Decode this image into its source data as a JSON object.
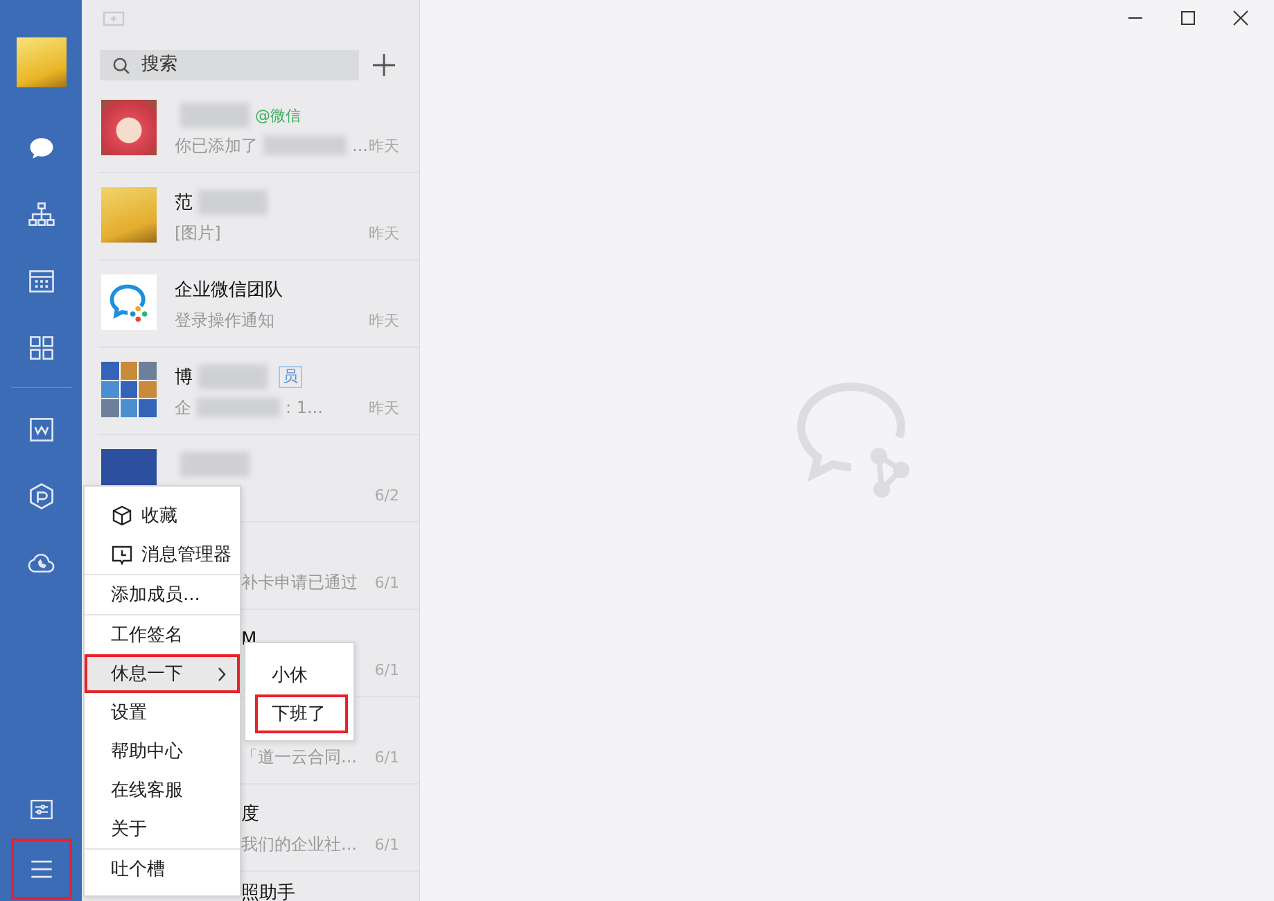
{
  "nav": {
    "top_items": [
      {
        "selected": true
      },
      {
        "selected": false
      },
      {
        "selected": false
      },
      {
        "selected": false
      }
    ],
    "app_items": [
      {
        "selected": false
      },
      {
        "selected": false
      },
      {
        "selected": false
      }
    ],
    "bottom_items": [
      {
        "highlighted": false
      },
      {
        "highlighted": true
      }
    ]
  },
  "search": {
    "placeholder": "搜索"
  },
  "chats": [
    {
      "kind": "full",
      "name": [
        {
          "kind": "blur"
        },
        {
          "kind": "mention",
          "text": "@微信"
        }
      ],
      "preview": [
        {
          "kind": "text",
          "text": "你已添加了"
        },
        {
          "kind": "blur"
        },
        {
          "kind": "text",
          "text": "..."
        }
      ],
      "time": "昨天"
    },
    {
      "kind": "full",
      "name": [
        {
          "kind": "text",
          "text": "范"
        },
        {
          "kind": "blur"
        }
      ],
      "preview": [
        {
          "kind": "text",
          "text": "[图片]"
        }
      ],
      "time": "昨天"
    },
    {
      "kind": "full",
      "name": [
        {
          "kind": "text",
          "text": "企业微信团队"
        }
      ],
      "preview": [
        {
          "kind": "text",
          "text": "登录操作通知"
        }
      ],
      "time": "昨天"
    },
    {
      "kind": "full",
      "name": [
        {
          "kind": "text",
          "text": "博"
        },
        {
          "kind": "blur"
        },
        {
          "kind": "tag",
          "text": "员"
        }
      ],
      "preview": [
        {
          "kind": "text",
          "text": "企"
        },
        {
          "kind": "blur"
        },
        {
          "kind": "text",
          "text": ": 1..."
        }
      ],
      "time": "昨天"
    },
    {
      "kind": "full",
      "name": [
        {
          "kind": "blur"
        }
      ],
      "time": "6/2"
    },
    {
      "kind": "behind",
      "preview": [
        {
          "kind": "text",
          "text": "补卡申请已通过"
        }
      ],
      "time": "6/1"
    },
    {
      "kind": "behind",
      "name": [
        {
          "kind": "text",
          "text": "M"
        }
      ],
      "time": "6/1"
    },
    {
      "kind": "behind",
      "preview": [
        {
          "kind": "text",
          "text": "「道一云合同..."
        }
      ],
      "time": "6/1"
    },
    {
      "kind": "behind",
      "name": [
        {
          "kind": "text",
          "text": "度"
        }
      ],
      "preview": [
        {
          "kind": "text",
          "text": "我们的企业社..."
        }
      ],
      "time": "6/1"
    },
    {
      "kind": "behind",
      "name": [
        {
          "kind": "text",
          "text": "照助手"
        }
      ]
    }
  ],
  "menu": {
    "items": [
      {
        "kind": "item",
        "label": "收藏",
        "submenu": false,
        "hovered": false,
        "highlighted": false
      },
      {
        "kind": "item",
        "label": "消息管理器",
        "submenu": false,
        "hovered": false,
        "highlighted": false
      },
      {
        "kind": "divider"
      },
      {
        "kind": "item",
        "label": "添加成员...",
        "submenu": false,
        "hovered": false,
        "highlighted": false
      },
      {
        "kind": "divider"
      },
      {
        "kind": "item",
        "label": "工作签名",
        "submenu": false,
        "hovered": false,
        "highlighted": false
      },
      {
        "kind": "item",
        "label": "休息一下",
        "submenu": true,
        "hovered": true,
        "highlighted": true
      },
      {
        "kind": "item",
        "label": "设置",
        "submenu": false,
        "hovered": false,
        "highlighted": false
      },
      {
        "kind": "item",
        "label": "帮助中心",
        "submenu": false,
        "hovered": false,
        "highlighted": false
      },
      {
        "kind": "item",
        "label": "在线客服",
        "submenu": false,
        "hovered": false,
        "highlighted": false
      },
      {
        "kind": "item",
        "label": "关于",
        "submenu": false,
        "hovered": false,
        "highlighted": false
      },
      {
        "kind": "divider"
      },
      {
        "kind": "item",
        "label": "吐个槽",
        "submenu": false,
        "hovered": false,
        "highlighted": false
      }
    ]
  },
  "submenu": {
    "items": [
      {
        "label": "小休",
        "highlighted": false
      },
      {
        "label": "下班了",
        "highlighted": true
      }
    ]
  }
}
